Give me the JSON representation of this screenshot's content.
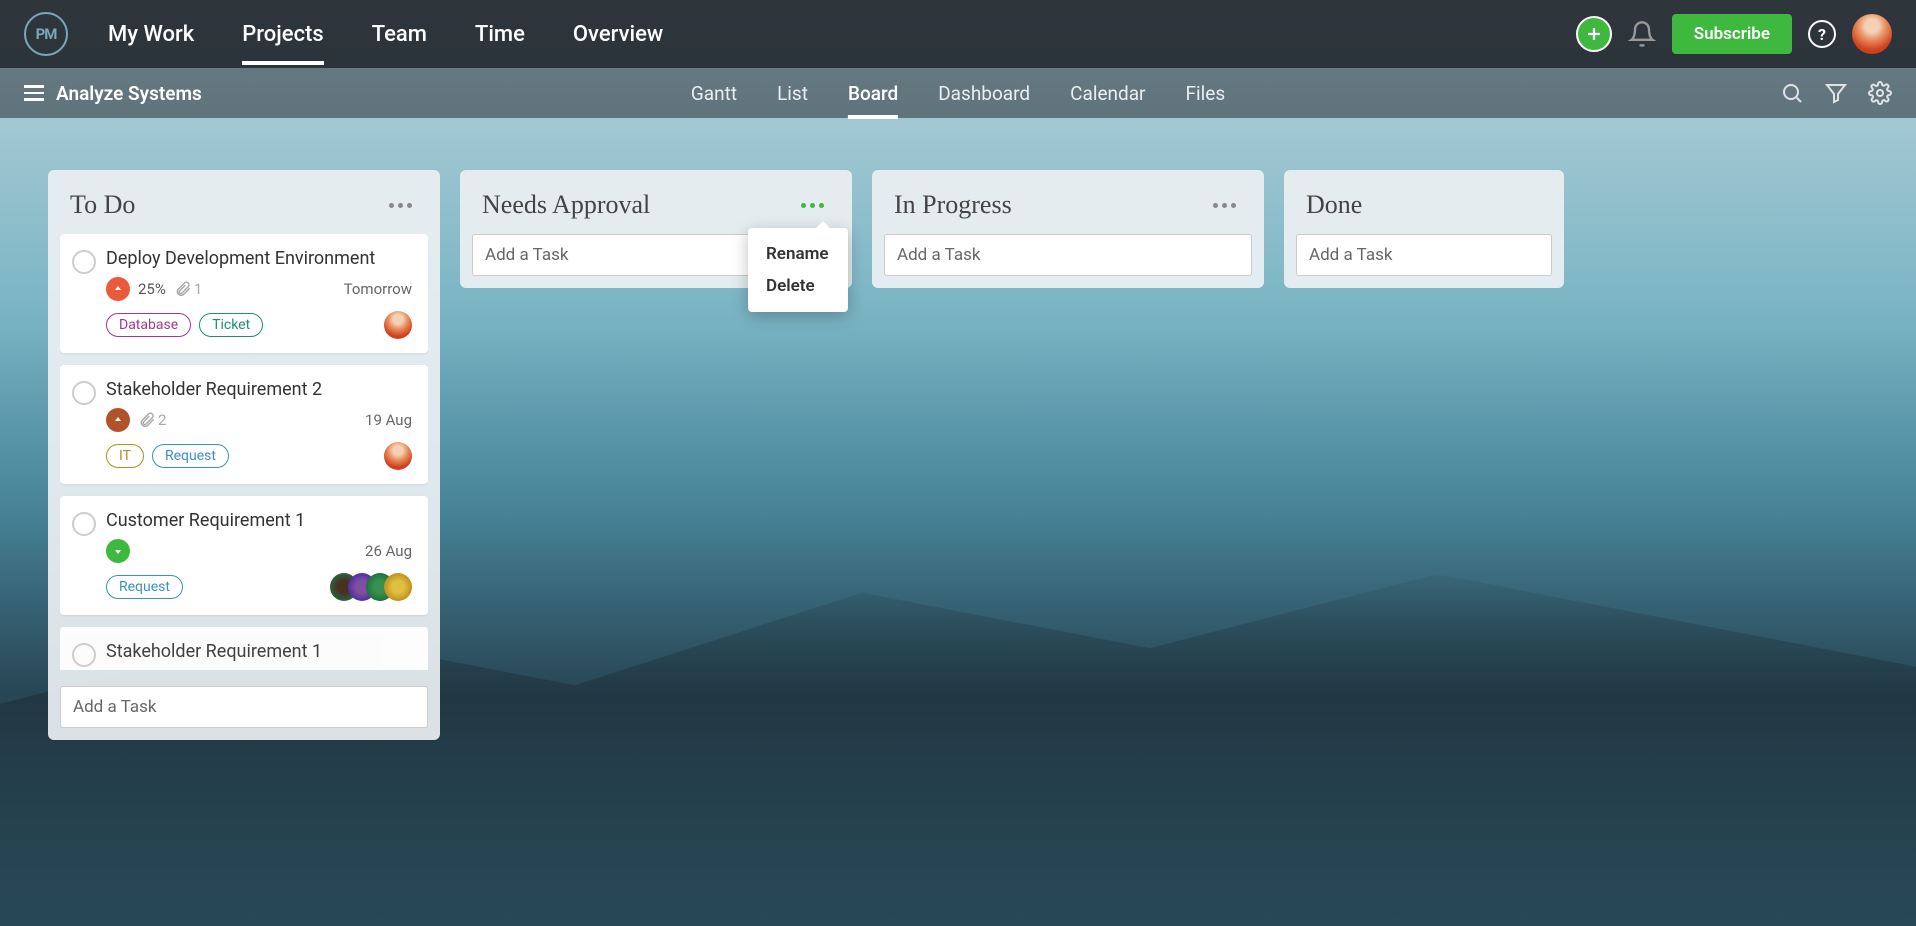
{
  "topnav": {
    "logo_text": "PM",
    "items": [
      "My Work",
      "Projects",
      "Team",
      "Time",
      "Overview"
    ],
    "active_index": 1,
    "subscribe_label": "Subscribe"
  },
  "subnav": {
    "project_name": "Analyze Systems",
    "tabs": [
      "Gantt",
      "List",
      "Board",
      "Dashboard",
      "Calendar",
      "Files"
    ],
    "active_index": 2
  },
  "add_task_placeholder": "Add a Task",
  "dropdown": {
    "rename": "Rename",
    "delete": "Delete"
  },
  "columns": [
    {
      "title": "To Do",
      "cards": [
        {
          "title": "Deploy Development Environment",
          "priority": "high",
          "percent": "25%",
          "attachments": "1",
          "date": "Tomorrow",
          "tags": [
            "Database",
            "Ticket"
          ],
          "avatar": "single"
        },
        {
          "title": "Stakeholder Requirement 2",
          "priority": "med",
          "attachments": "2",
          "date": "19 Aug",
          "tags": [
            "IT",
            "Request"
          ],
          "avatar": "single"
        },
        {
          "title": "Customer Requirement 1",
          "priority": "low",
          "date": "26 Aug",
          "tags": [
            "Request"
          ],
          "avatar": "stack"
        },
        {
          "title": "Stakeholder Requirement 1",
          "truncated": true
        }
      ]
    },
    {
      "title": "Needs Approval",
      "open": true
    },
    {
      "title": "In Progress"
    },
    {
      "title": "Done"
    }
  ]
}
